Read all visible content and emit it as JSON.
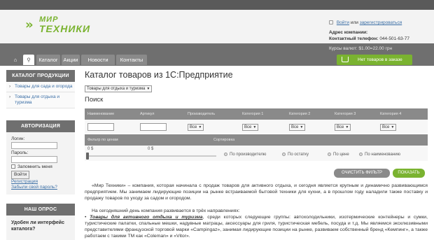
{
  "header": {
    "logo_line1": "МИР",
    "logo_line2": "ТЕХНИКИ",
    "login_link": "Войти",
    "login_or": "или",
    "register_link": "зарегистрироваться",
    "address_label": "Адрес компании:",
    "phone_label": "Контактный телефон:",
    "phone_value": "044-501-63-77",
    "rates": "Курсы валют:  $1.00=22.00 грн"
  },
  "nav": {
    "tabs": [
      "Каталог",
      "Акции",
      "Новости",
      "Контакты"
    ],
    "cart_label": "Нет товаров в заказе"
  },
  "sidebar": {
    "catalog_title": "КАТАЛОГ ПРОДУКЦИИ",
    "catalog_items": [
      "Товары для сада и огорода",
      "Товары для отдыха и туризма"
    ],
    "auth_title": "АВТОРИЗАЦИЯ",
    "login_label": "Логин:",
    "password_label": "Пароль:",
    "remember_label": "Запомнить меня",
    "login_button": "Войти",
    "register_link": "Регистрация",
    "forgot_link": "Забыли свой пароль?",
    "poll_title": "НАШ ОПРОС",
    "poll_question": "Удобен ли интерфейс каталога?"
  },
  "main": {
    "title": "Каталог товаров из 1С:Предприятие",
    "category_select": "Товары для отдыха и туризма",
    "search_title": "Поиск",
    "filter_columns": [
      "Наименование",
      "Артикул",
      "Производитель",
      "Категория 1",
      "Категория 2",
      "Категория 3",
      "Категория 4"
    ],
    "select_all": "Все",
    "price_filter_label": "Фильтр по ценам",
    "sort_label": "Сортировка",
    "price_from": "0 $",
    "price_to": "0 $",
    "sort_options": [
      "По производителю",
      "По остатку",
      "По цене",
      "По наименованию"
    ],
    "clear_button": "ОЧИСТИТЬ ФИЛЬТР",
    "show_button": "ПОКАЗАТЬ",
    "para1": "«Мир Техники» – компания, которая начинала с продаж товаров для активного отдыха, и сегодня является крупным и динамично развивающимся предприятием. Мы занимаем лидирующие позиции на рынке встраиваемой бытовой техники для кухни, а в прошлом году наладили также поставку и продажу товаров по уходу за садом и огородом.",
    "para2": "На сегодняшний день компания развивается в трёх направлениях:",
    "bullet_title": "Товары для активного отдыха и туризма",
    "bullet_text": ", среди которых следующие группы: автохолодильники, изотермические контейнеры и сумки, туристические палатки, спальные мешки, надувные матрацы, аксессуары для гриля, туристическая мебель, посуда и т.д. Мы являемся эксклюзивными представителями французской торговой марки «Campingaz», занимая лидирующие позиции на рынке, развиваем собственный бренд «Кемпинг», а также работаем с такими ТМ как «Coleman» и «Vitor»."
  },
  "colors": {
    "accent_green": "#7ab330",
    "nav_gray": "#6f6f6f",
    "link_blue": "#3a6ea5"
  }
}
